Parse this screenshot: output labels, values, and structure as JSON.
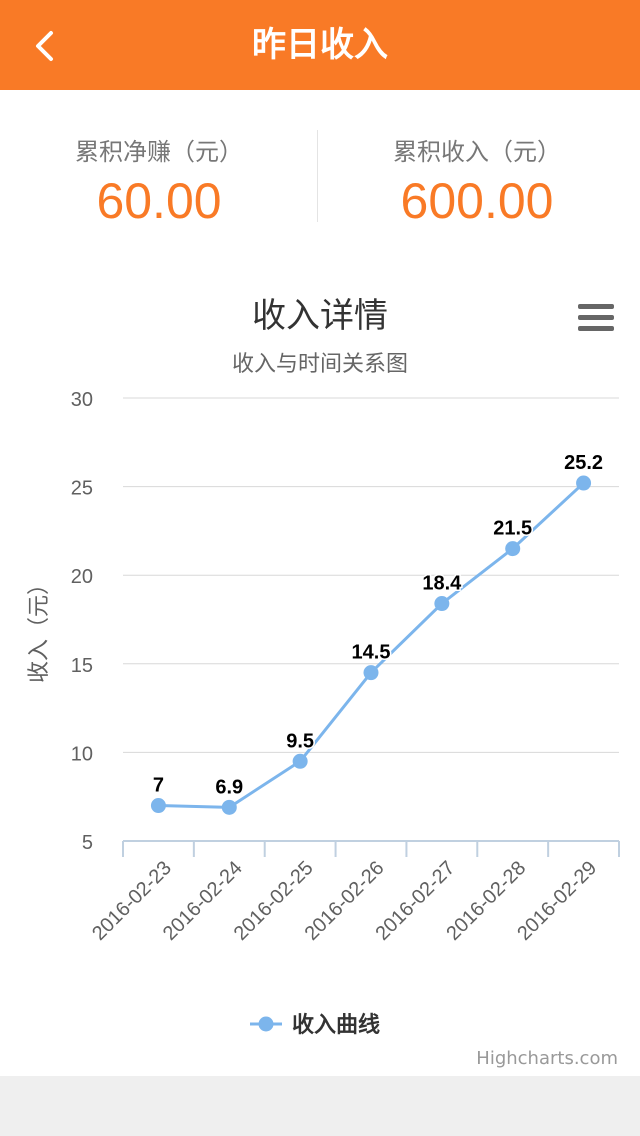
{
  "header": {
    "title": "昨日收入",
    "back_icon": "chevron-left-icon"
  },
  "stats": {
    "net_label": "累积净赚（元）",
    "net_value": "60.00",
    "income_label": "累积收入（元）",
    "income_value": "600.00"
  },
  "credits": "Highcharts.com",
  "menu_icon": "hamburger-menu-icon",
  "colors": {
    "accent": "#f97a26",
    "series": "#7cb5ec"
  },
  "chart_data": {
    "type": "line",
    "title": "收入详情",
    "subtitle": "收入与时间关系图",
    "ylabel": "收入（元）",
    "xlabel": "",
    "categories": [
      "2016-02-23",
      "2016-02-24",
      "2016-02-25",
      "2016-02-26",
      "2016-02-27",
      "2016-02-28",
      "2016-02-29"
    ],
    "series": [
      {
        "name": "收入曲线",
        "values": [
          7,
          6.9,
          9.5,
          14.5,
          18.4,
          21.5,
          25.2
        ]
      }
    ],
    "ylim": [
      5,
      30
    ],
    "yticks": [
      5,
      10,
      15,
      20,
      25,
      30
    ],
    "grid": true,
    "legend": "bottom-center",
    "data_labels": true
  }
}
